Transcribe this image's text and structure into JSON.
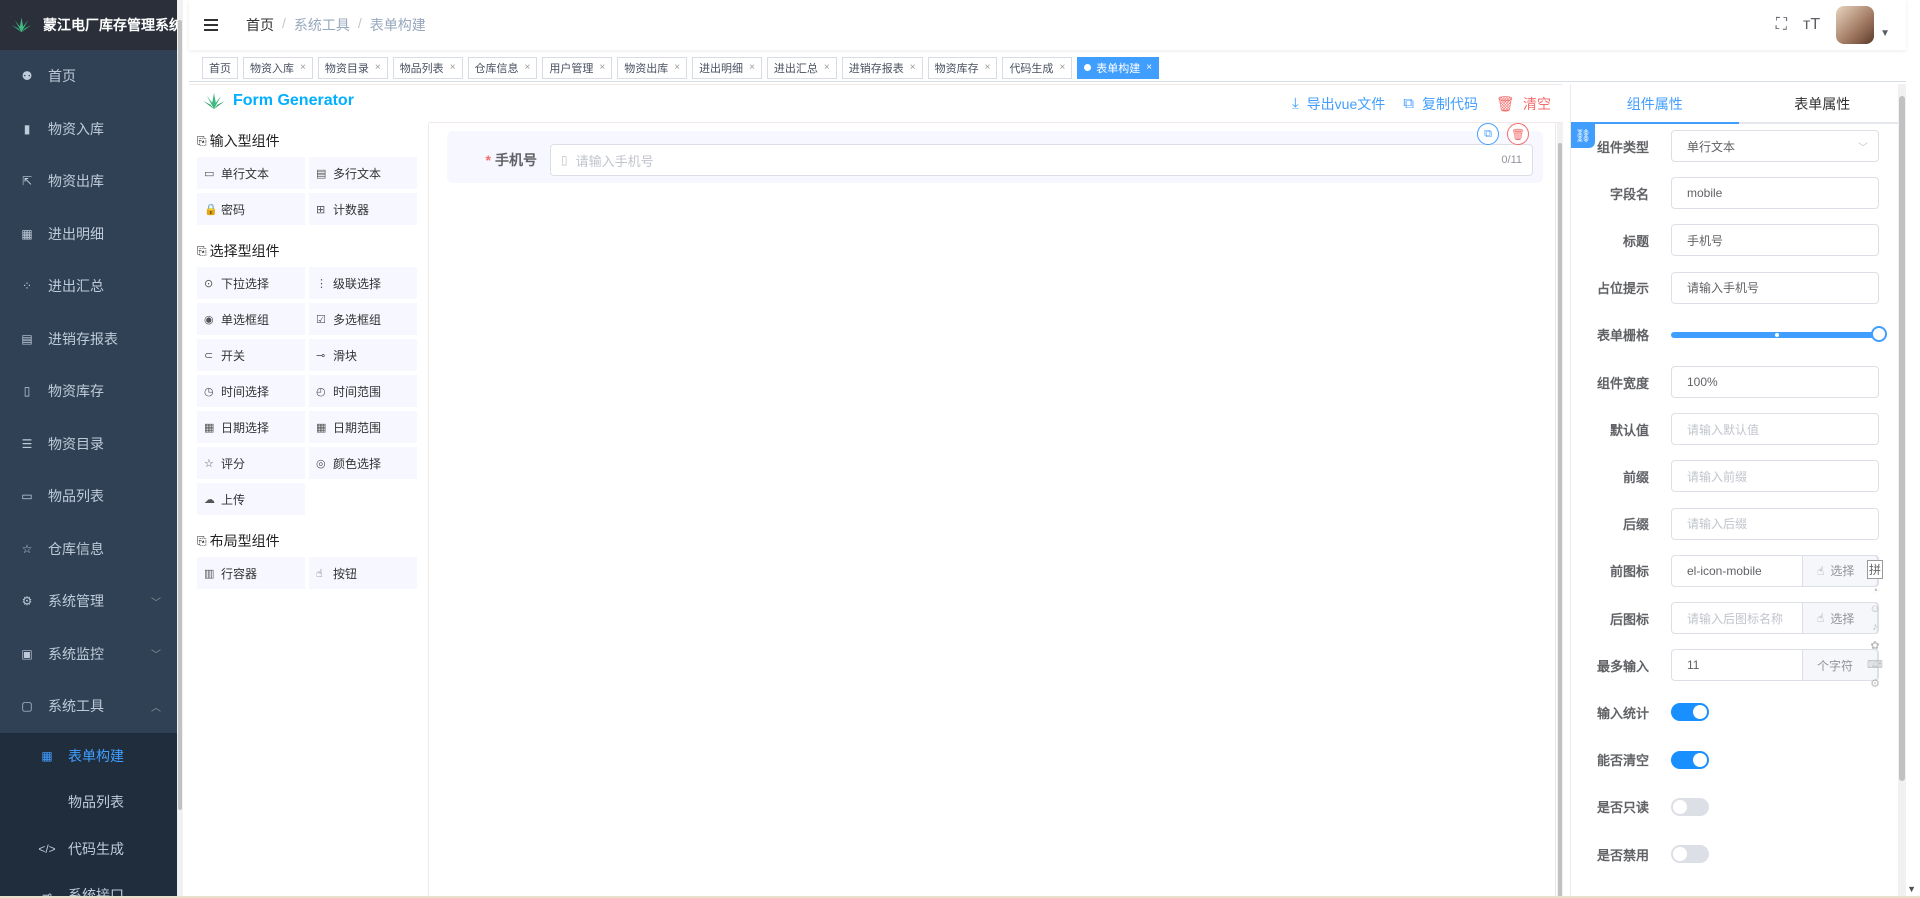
{
  "app": {
    "title": "蒙江电厂库存管理系统"
  },
  "sidebar": {
    "items": [
      {
        "label": "首页",
        "icon": "dashboard-icon"
      },
      {
        "label": "物资入库",
        "icon": "inbound-icon"
      },
      {
        "label": "物资出库",
        "icon": "outbound-icon"
      },
      {
        "label": "进出明细",
        "icon": "table-icon"
      },
      {
        "label": "进出汇总",
        "icon": "summary-icon"
      },
      {
        "label": "进销存报表",
        "icon": "calendar-icon"
      },
      {
        "label": "物资库存",
        "icon": "book-icon"
      },
      {
        "label": "物资目录",
        "icon": "tree-icon"
      },
      {
        "label": "物品列表",
        "icon": "list-icon"
      },
      {
        "label": "仓库信息",
        "icon": "star-icon"
      },
      {
        "label": "系统管理",
        "icon": "gear-icon"
      },
      {
        "label": "系统监控",
        "icon": "monitor-icon"
      },
      {
        "label": "系统工具",
        "icon": "toolbox-icon"
      }
    ],
    "submenu": [
      {
        "label": "表单构建",
        "active": true
      },
      {
        "label": "物品列表",
        "active": false
      },
      {
        "label": "代码生成",
        "active": false
      },
      {
        "label": "系统接口",
        "active": false
      }
    ]
  },
  "navbar": {
    "breadcrumb": [
      "首页",
      "系统工具",
      "表单构建"
    ]
  },
  "tags": [
    {
      "label": "首页",
      "closable": false,
      "active": false
    },
    {
      "label": "物资入库",
      "closable": true,
      "active": false
    },
    {
      "label": "物资目录",
      "closable": true,
      "active": false
    },
    {
      "label": "物品列表",
      "closable": true,
      "active": false
    },
    {
      "label": "仓库信息",
      "closable": true,
      "active": false
    },
    {
      "label": "用户管理",
      "closable": true,
      "active": false
    },
    {
      "label": "物资出库",
      "closable": true,
      "active": false
    },
    {
      "label": "进出明细",
      "closable": true,
      "active": false
    },
    {
      "label": "进出汇总",
      "closable": true,
      "active": false
    },
    {
      "label": "进销存报表",
      "closable": true,
      "active": false
    },
    {
      "label": "物资库存",
      "closable": true,
      "active": false
    },
    {
      "label": "代码生成",
      "closable": true,
      "active": false
    },
    {
      "label": "表单构建",
      "closable": true,
      "active": true
    }
  ],
  "generator": {
    "title": "Form Generator",
    "groups": [
      {
        "title": "输入型组件",
        "items": [
          {
            "label": "单行文本",
            "icon": "▭"
          },
          {
            "label": "多行文本",
            "icon": "▤"
          },
          {
            "label": "密码",
            "icon": "🔒"
          },
          {
            "label": "计数器",
            "icon": "⊞"
          }
        ]
      },
      {
        "title": "选择型组件",
        "items": [
          {
            "label": "下拉选择",
            "icon": "⊙"
          },
          {
            "label": "级联选择",
            "icon": "⋮"
          },
          {
            "label": "单选框组",
            "icon": "◉"
          },
          {
            "label": "多选框组",
            "icon": "☑"
          },
          {
            "label": "开关",
            "icon": "⊂"
          },
          {
            "label": "滑块",
            "icon": "⊸"
          },
          {
            "label": "时间选择",
            "icon": "◷"
          },
          {
            "label": "时间范围",
            "icon": "◴"
          },
          {
            "label": "日期选择",
            "icon": "▦"
          },
          {
            "label": "日期范围",
            "icon": "▦"
          },
          {
            "label": "评分",
            "icon": "☆"
          },
          {
            "label": "颜色选择",
            "icon": "◎"
          },
          {
            "label": "上传",
            "icon": "☁"
          }
        ]
      },
      {
        "title": "布局型组件",
        "items": [
          {
            "label": "行容器",
            "icon": "▥"
          },
          {
            "label": "按钮",
            "icon": "☝"
          }
        ]
      }
    ],
    "actions": {
      "export": "导出vue文件",
      "copy": "复制代码",
      "clear": "清空"
    },
    "field": {
      "label": "手机号",
      "placeholder": "请输入手机号",
      "count": "0/11"
    }
  },
  "props": {
    "tabs": [
      "组件属性",
      "表单属性"
    ],
    "rows": [
      {
        "label": "组件类型",
        "kind": "select",
        "value": "单行文本"
      },
      {
        "label": "字段名",
        "kind": "input",
        "value": "mobile"
      },
      {
        "label": "标题",
        "kind": "input",
        "value": "手机号"
      },
      {
        "label": "占位提示",
        "kind": "input",
        "value": "请输入手机号"
      },
      {
        "label": "表单栅格",
        "kind": "slider",
        "value": 24
      },
      {
        "label": "组件宽度",
        "kind": "input",
        "value": "100%"
      },
      {
        "label": "默认值",
        "kind": "placeholder",
        "value": "请输入默认值"
      },
      {
        "label": "前缀",
        "kind": "placeholder",
        "value": "请输入前缀"
      },
      {
        "label": "后缀",
        "kind": "placeholder",
        "value": "请输入后缀"
      },
      {
        "label": "前图标",
        "kind": "append",
        "value": "el-icon-mobile",
        "append": "选择"
      },
      {
        "label": "后图标",
        "kind": "append-ph",
        "value": "请输入后图标名称",
        "append": "选择"
      },
      {
        "label": "最多输入",
        "kind": "append",
        "value": "11",
        "append": "个字符"
      },
      {
        "label": "输入统计",
        "kind": "switch",
        "on": true
      },
      {
        "label": "能否清空",
        "kind": "switch",
        "on": true
      },
      {
        "label": "是否只读",
        "kind": "switch",
        "on": false
      },
      {
        "label": "是否禁用",
        "kind": "switch",
        "on": false
      }
    ]
  },
  "ime": {
    "key": "拼"
  }
}
